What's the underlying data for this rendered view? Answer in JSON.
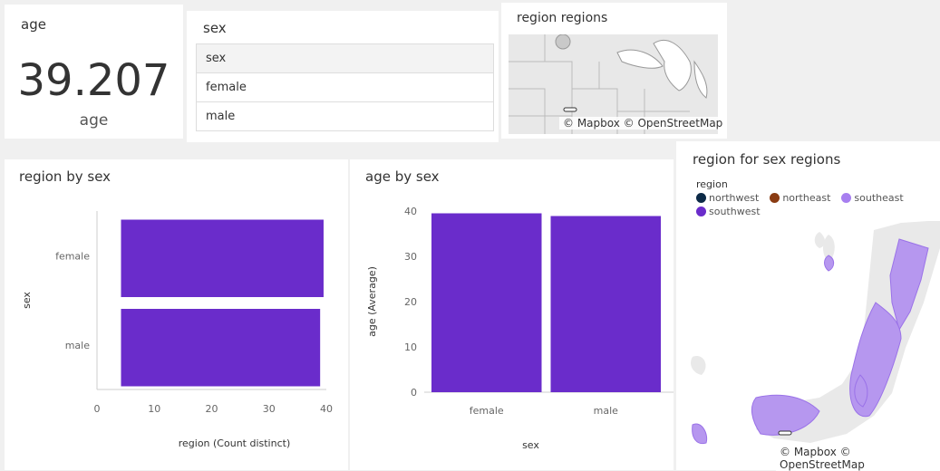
{
  "kpi": {
    "title": "age",
    "value": "39.207",
    "label": "age"
  },
  "table": {
    "title": "sex",
    "header": "sex",
    "rows": [
      "female",
      "male"
    ]
  },
  "map1": {
    "title": "region regions",
    "attribution": "© Mapbox © OpenStreetMap"
  },
  "map2": {
    "title": "region for sex regions",
    "legend_title": "region",
    "legend": [
      {
        "label": "northwest",
        "color": "#0c2a47"
      },
      {
        "label": "northeast",
        "color": "#8a3b12"
      },
      {
        "label": "southeast",
        "color": "#a77ff0"
      },
      {
        "label": "southwest",
        "color": "#6a2ccb"
      }
    ],
    "attribution": "© Mapbox © OpenStreetMap"
  },
  "chart_data": [
    {
      "type": "bar",
      "orientation": "horizontal",
      "title": "region by sex",
      "categories": [
        "female",
        "male"
      ],
      "values": [
        39.6,
        39.0
      ],
      "xlabel": "region (Count distinct)",
      "ylabel": "sex",
      "xlim": [
        0,
        40
      ],
      "xticks": [
        0,
        10,
        20,
        30,
        40
      ],
      "color": "#6a2ccb"
    },
    {
      "type": "bar",
      "title": "age by sex",
      "categories": [
        "female",
        "male"
      ],
      "values": [
        39.5,
        38.9
      ],
      "xlabel": "sex",
      "ylabel": "age (Average)",
      "ylim": [
        0,
        40
      ],
      "yticks": [
        0,
        10,
        20,
        30,
        40
      ],
      "color": "#6a2ccb"
    }
  ]
}
